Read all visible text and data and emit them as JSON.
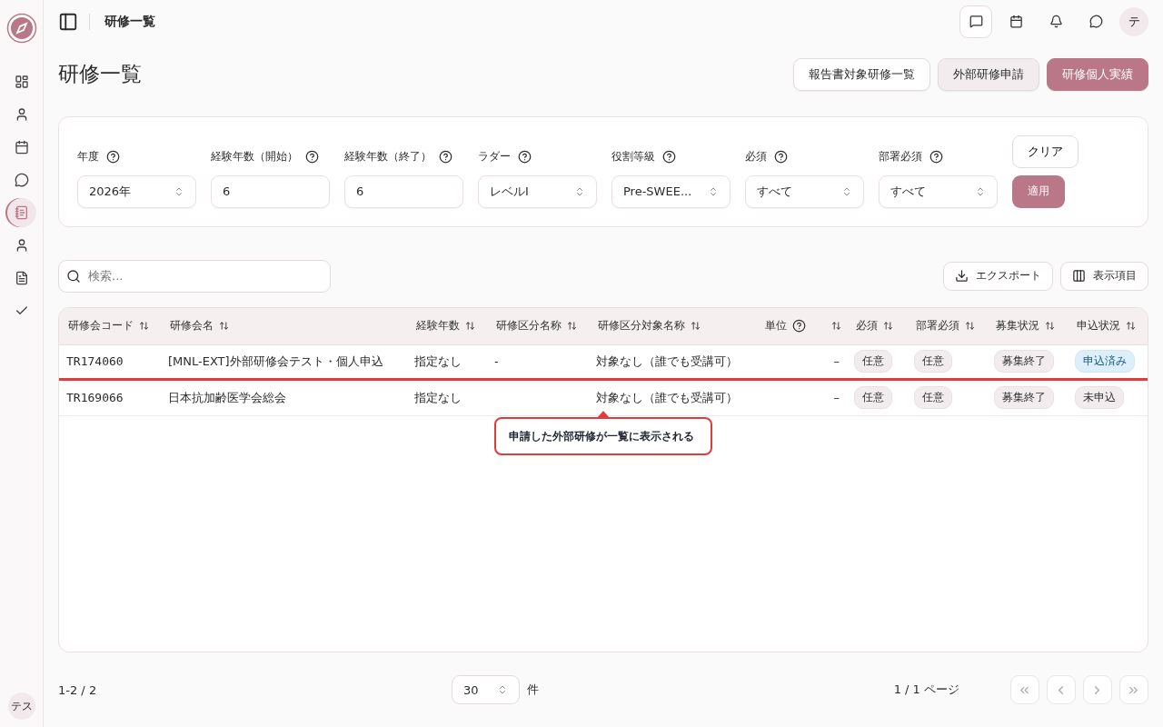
{
  "sidebar": {
    "items": [
      {
        "selected": false
      },
      {
        "selected": false
      },
      {
        "selected": false
      },
      {
        "selected": false
      },
      {
        "selected": true
      },
      {
        "selected": false
      },
      {
        "selected": false
      },
      {
        "selected": false
      }
    ],
    "user": "テス"
  },
  "topbar": {
    "title": "研修一覧",
    "icons": [
      {
        "selected": true
      },
      {
        "selected": false
      },
      {
        "selected": false
      },
      {
        "selected": false
      }
    ],
    "avatar": "テ"
  },
  "page_title": "研修一覧",
  "actions": [
    {
      "label": "報告書対象研修一覧",
      "kind": "outline"
    },
    {
      "label": "外部研修申請",
      "kind": "soft"
    },
    {
      "label": "研修個人実績",
      "kind": "primary"
    }
  ],
  "filters": [
    {
      "label": "年度",
      "kind": "select",
      "value": "2026年"
    },
    {
      "label": "経験年数（開始）",
      "kind": "input",
      "value": "6"
    },
    {
      "label": "経験年数（終了）",
      "kind": "input",
      "value": "6"
    },
    {
      "label": "ラダー",
      "kind": "select",
      "value": "レベルI"
    },
    {
      "label": "役割等級",
      "kind": "select",
      "value": "Pre-SWEE..."
    },
    {
      "label": "必須",
      "kind": "select",
      "value": "すべて"
    },
    {
      "label": "部署必須",
      "kind": "select",
      "value": "すべて"
    }
  ],
  "filter_buttons": {
    "clear": "クリア",
    "apply": "適用"
  },
  "search": {
    "placeholder": "検索..."
  },
  "tools": [
    {
      "label": "エクスポート"
    },
    {
      "label": "表示項目"
    }
  ],
  "table": {
    "columns": [
      {
        "label": "研修会コード",
        "help": false
      },
      {
        "label": "研修会名",
        "help": false
      },
      {
        "label": "経験年数",
        "help": false
      },
      {
        "label": "研修区分名称",
        "help": false
      },
      {
        "label": "研修区分対象名称",
        "help": false
      },
      {
        "label": "単位",
        "help": true
      },
      {
        "label": "必須",
        "help": false
      },
      {
        "label": "部署必須",
        "help": false
      },
      {
        "label": "募集状況",
        "help": false
      },
      {
        "label": "申込状況",
        "help": false
      }
    ],
    "rows": [
      {
        "highlighted": true,
        "code": "TR174060",
        "name": "[MNL-EXT]外部研修会テスト・個人申込",
        "years": "指定なし",
        "category": "-",
        "target": "対象なし（誰でも受講可）",
        "unit": "–",
        "required": "任意",
        "dept_required": "任意",
        "recruit": "募集終了",
        "status": {
          "label": "申込済み",
          "kind": "info"
        }
      },
      {
        "highlighted": false,
        "code": "TR169066",
        "name": "日本抗加齢医学会総会",
        "years": "指定なし",
        "target": "対象なし（誰でも受講可）",
        "unit": "–",
        "required": "任意",
        "dept_required": "任意",
        "recruit": "募集終了",
        "status": {
          "label": "未申込",
          "kind": "neutral"
        }
      }
    ]
  },
  "callout": {
    "text": "申請した外部研修が一覧に表示される"
  },
  "pagination": {
    "range": "1-2 / 2",
    "page_size": "30",
    "unit": "件",
    "page": "1 / 1 ページ",
    "nav": [
      {
        "disabled": true
      },
      {
        "disabled": true
      },
      {
        "disabled": true
      },
      {
        "disabled": true
      }
    ]
  }
}
